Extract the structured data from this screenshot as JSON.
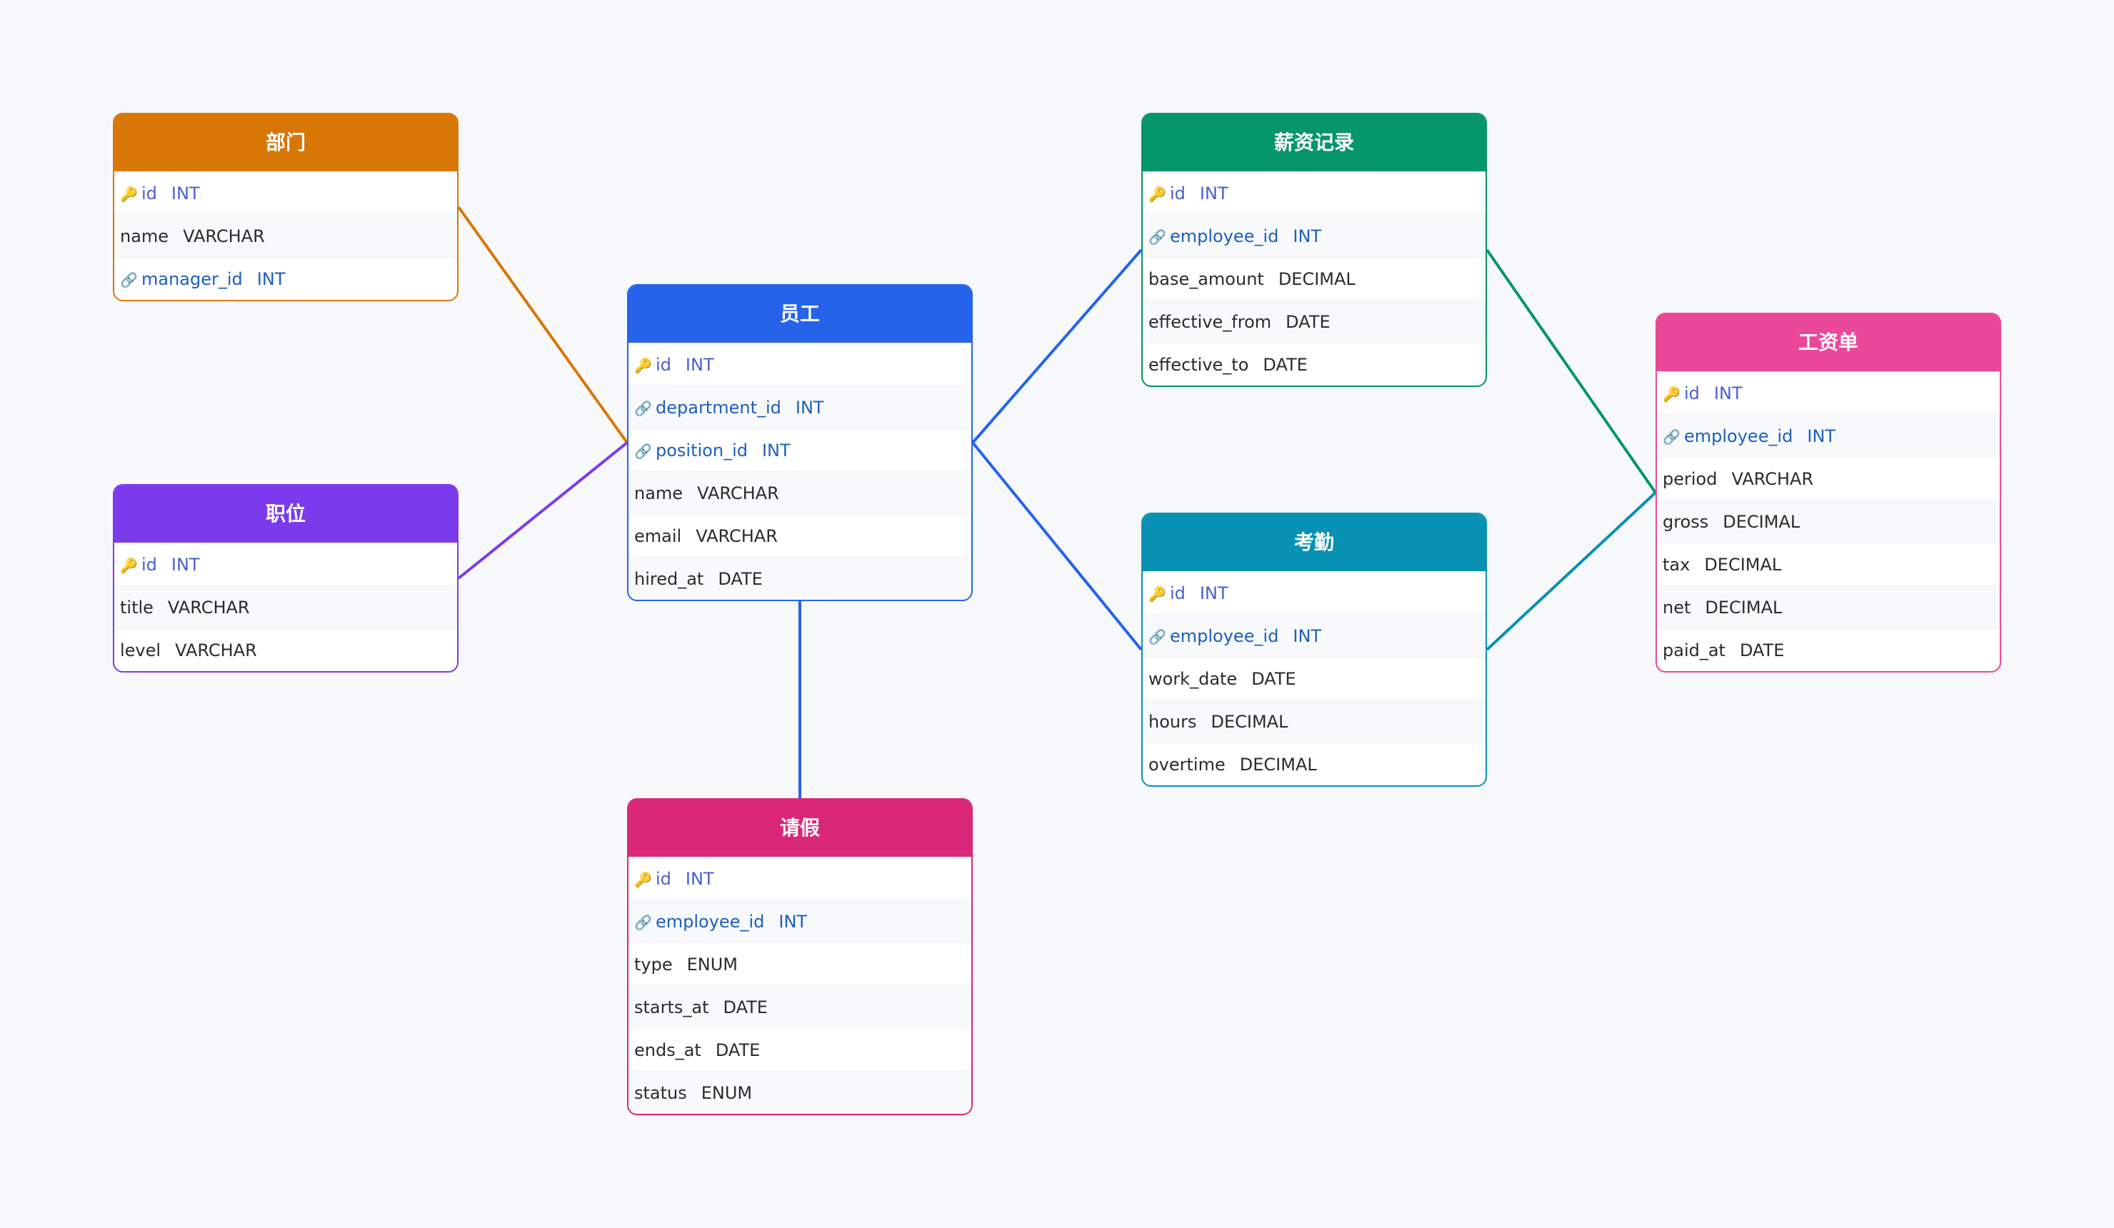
{
  "entities": {
    "department": {
      "title": "部门",
      "color": "#d97706",
      "fields": [
        {
          "name": "id",
          "type": "INT",
          "key": "pk",
          "icon": "key-icon"
        },
        {
          "name": "name",
          "type": "VARCHAR",
          "key": "",
          "icon": ""
        },
        {
          "name": "manager_id",
          "type": "INT",
          "key": "fk",
          "icon": "link-icon"
        }
      ]
    },
    "position": {
      "title": "职位",
      "color": "#7c3aed",
      "fields": [
        {
          "name": "id",
          "type": "INT",
          "key": "pk",
          "icon": "key-icon"
        },
        {
          "name": "title",
          "type": "VARCHAR",
          "key": "",
          "icon": ""
        },
        {
          "name": "level",
          "type": "VARCHAR",
          "key": "",
          "icon": ""
        }
      ]
    },
    "employee": {
      "title": "员工",
      "color": "#2563eb",
      "fields": [
        {
          "name": "id",
          "type": "INT",
          "key": "pk",
          "icon": "key-icon"
        },
        {
          "name": "department_id",
          "type": "INT",
          "key": "fk",
          "icon": "link-icon"
        },
        {
          "name": "position_id",
          "type": "INT",
          "key": "fk",
          "icon": "link-icon"
        },
        {
          "name": "name",
          "type": "VARCHAR",
          "key": "",
          "icon": ""
        },
        {
          "name": "email",
          "type": "VARCHAR",
          "key": "",
          "icon": ""
        },
        {
          "name": "hired_at",
          "type": "DATE",
          "key": "",
          "icon": ""
        }
      ]
    },
    "leave": {
      "title": "请假",
      "color": "#db2777",
      "fields": [
        {
          "name": "id",
          "type": "INT",
          "key": "pk",
          "icon": "key-icon"
        },
        {
          "name": "employee_id",
          "type": "INT",
          "key": "fk",
          "icon": "link-icon"
        },
        {
          "name": "type",
          "type": "ENUM",
          "key": "",
          "icon": ""
        },
        {
          "name": "starts_at",
          "type": "DATE",
          "key": "",
          "icon": ""
        },
        {
          "name": "ends_at",
          "type": "DATE",
          "key": "",
          "icon": ""
        },
        {
          "name": "status",
          "type": "ENUM",
          "key": "",
          "icon": ""
        }
      ]
    },
    "salary": {
      "title": "薪资记录",
      "color": "#059669",
      "fields": [
        {
          "name": "id",
          "type": "INT",
          "key": "pk",
          "icon": "key-icon"
        },
        {
          "name": "employee_id",
          "type": "INT",
          "key": "fk",
          "icon": "link-icon"
        },
        {
          "name": "base_amount",
          "type": "DECIMAL",
          "key": "",
          "icon": ""
        },
        {
          "name": "effective_from",
          "type": "DATE",
          "key": "",
          "icon": ""
        },
        {
          "name": "effective_to",
          "type": "DATE",
          "key": "",
          "icon": ""
        }
      ]
    },
    "attendance": {
      "title": "考勤",
      "color": "#0891b2",
      "fields": [
        {
          "name": "id",
          "type": "INT",
          "key": "pk",
          "icon": "key-icon"
        },
        {
          "name": "employee_id",
          "type": "INT",
          "key": "fk",
          "icon": "link-icon"
        },
        {
          "name": "work_date",
          "type": "DATE",
          "key": "",
          "icon": ""
        },
        {
          "name": "hours",
          "type": "DECIMAL",
          "key": "",
          "icon": ""
        },
        {
          "name": "overtime",
          "type": "DECIMAL",
          "key": "",
          "icon": ""
        }
      ]
    },
    "payslip": {
      "title": "工资单",
      "color": "#ec4899",
      "fields": [
        {
          "name": "id",
          "type": "INT",
          "key": "pk",
          "icon": "key-icon"
        },
        {
          "name": "employee_id",
          "type": "INT",
          "key": "fk",
          "icon": "link-icon"
        },
        {
          "name": "period",
          "type": "VARCHAR",
          "key": "",
          "icon": ""
        },
        {
          "name": "gross",
          "type": "DECIMAL",
          "key": "",
          "icon": ""
        },
        {
          "name": "tax",
          "type": "DECIMAL",
          "key": "",
          "icon": ""
        },
        {
          "name": "net",
          "type": "DECIMAL",
          "key": "",
          "icon": ""
        },
        {
          "name": "paid_at",
          "type": "DATE",
          "key": "",
          "icon": ""
        }
      ]
    }
  },
  "relations": [
    {
      "from": "department",
      "to": "employee",
      "color": "#d97706"
    },
    {
      "from": "position",
      "to": "employee",
      "color": "#7c3aed"
    },
    {
      "from": "employee",
      "to": "salary",
      "color": "#2563eb"
    },
    {
      "from": "employee",
      "to": "attendance",
      "color": "#2563eb"
    },
    {
      "from": "employee",
      "to": "leave",
      "color": "#2563eb"
    },
    {
      "from": "salary",
      "to": "payslip",
      "color": "#059669"
    },
    {
      "from": "attendance",
      "to": "payslip",
      "color": "#0891b2"
    }
  ]
}
